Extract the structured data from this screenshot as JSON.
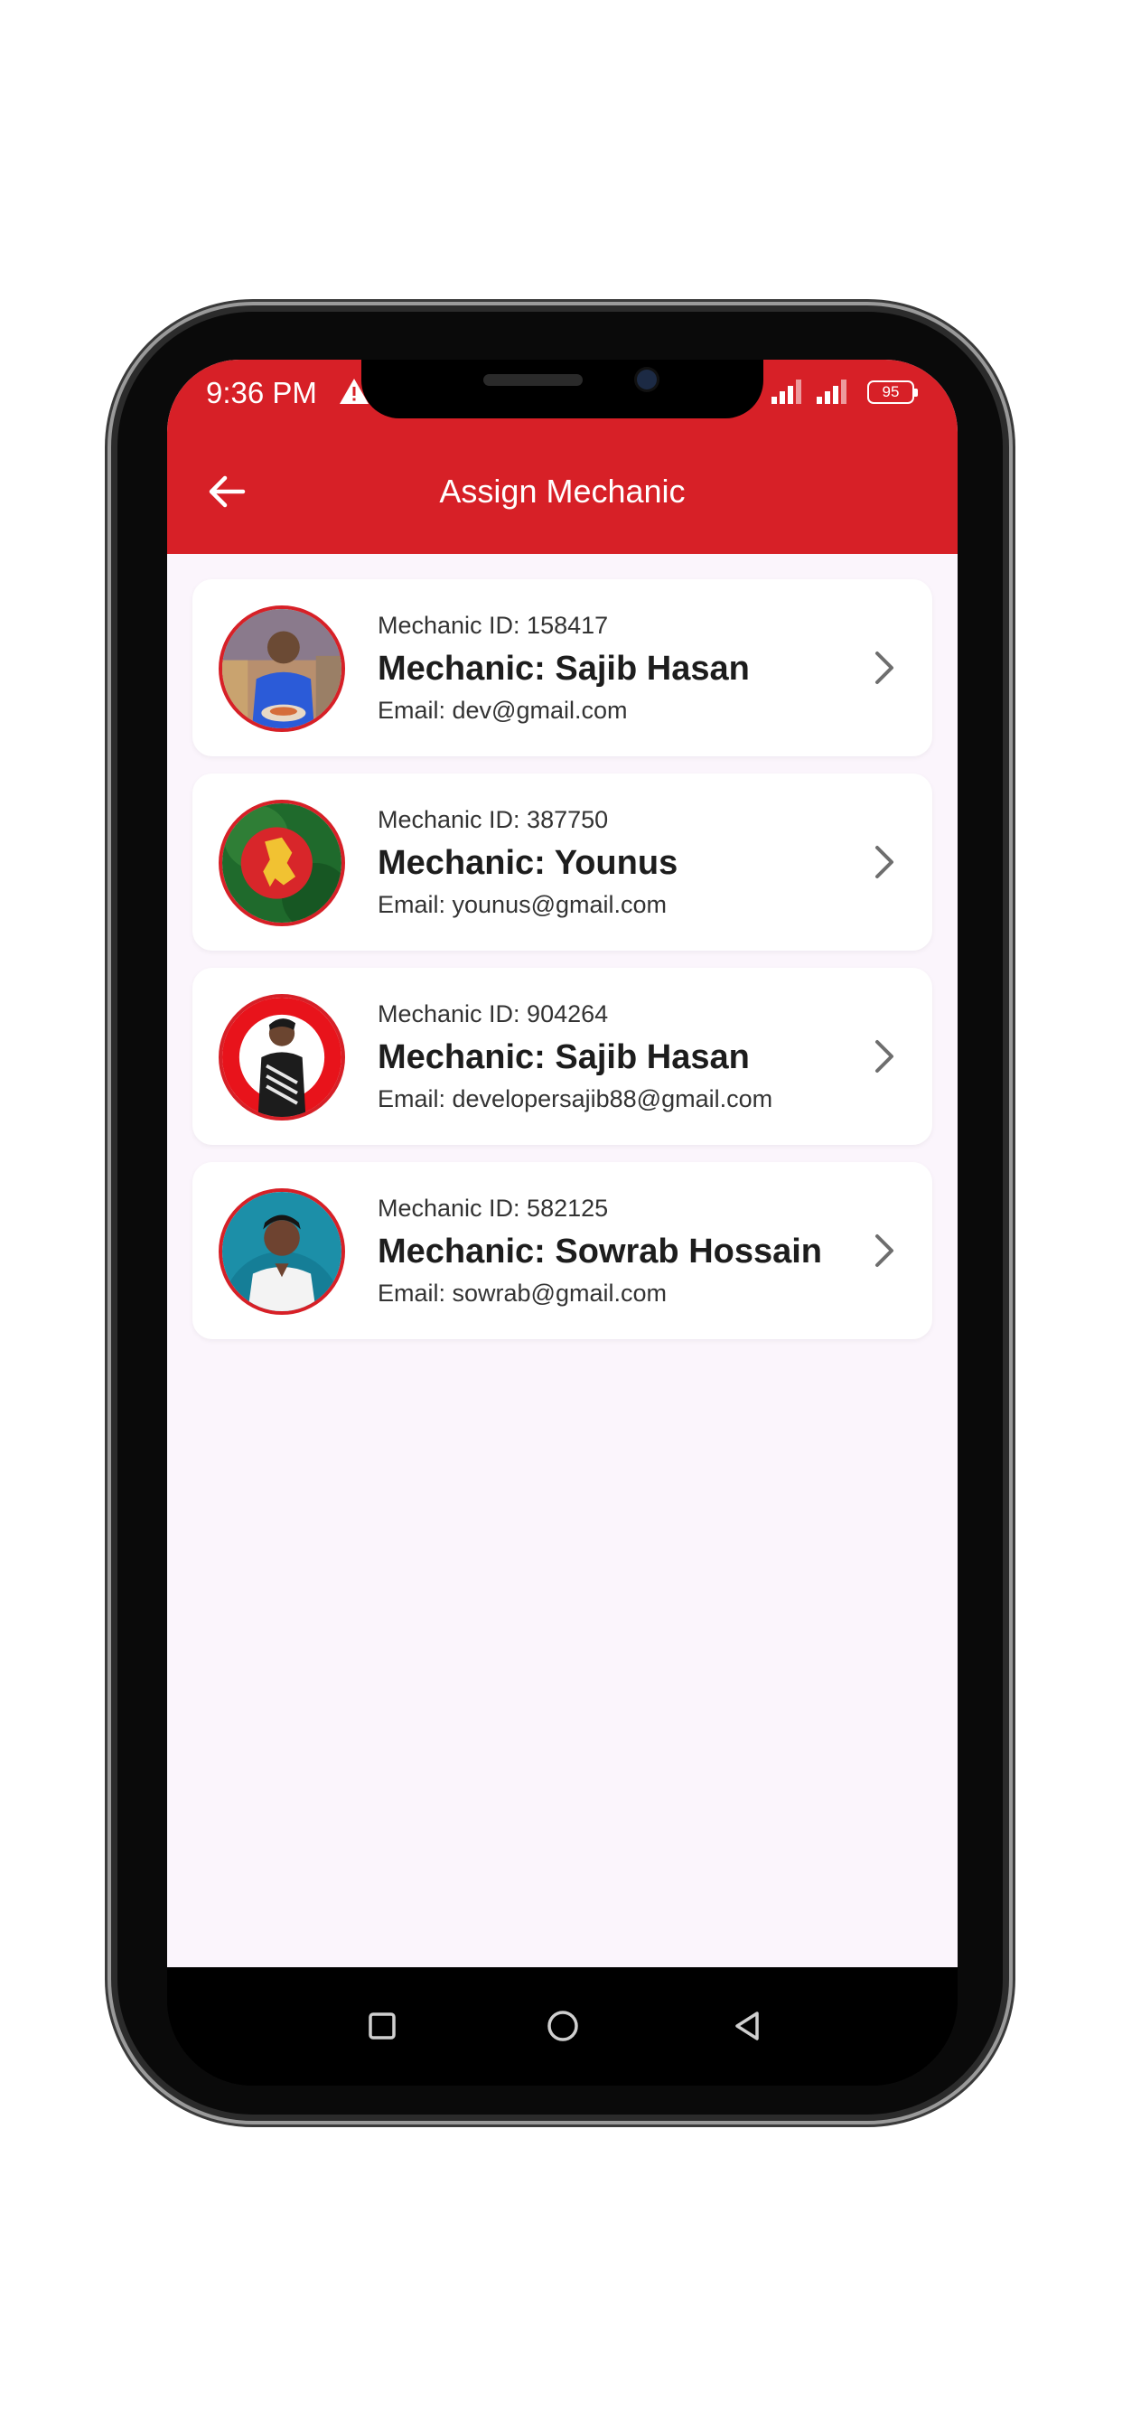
{
  "status_bar": {
    "time": "9:36 PM",
    "battery": "95"
  },
  "header": {
    "title": "Assign Mechanic"
  },
  "mechanics": [
    {
      "id_label": "Mechanic ID: 158417",
      "name": "Mechanic: Sajib Hasan",
      "email": "Email: dev@gmail.com"
    },
    {
      "id_label": "Mechanic ID: 387750",
      "name": "Mechanic: Younus",
      "email": "Email: younus@gmail.com"
    },
    {
      "id_label": "Mechanic ID: 904264",
      "name": "Mechanic: Sajib Hasan",
      "email": "Email: developersajib88@gmail.com"
    },
    {
      "id_label": "Mechanic ID: 582125",
      "name": "Mechanic: Sowrab Hossain",
      "email": "Email: sowrab@gmail.com"
    }
  ],
  "icons": {
    "back": "arrow-left-icon",
    "chevron": "chevron-right-icon",
    "warning": "warning-icon",
    "signal": "signal-icon",
    "nav_recent": "square-icon",
    "nav_home": "circle-icon",
    "nav_back": "triangle-back-icon"
  },
  "colors": {
    "accent": "#d72027",
    "background": "#fbf5fc",
    "card": "#ffffff"
  }
}
